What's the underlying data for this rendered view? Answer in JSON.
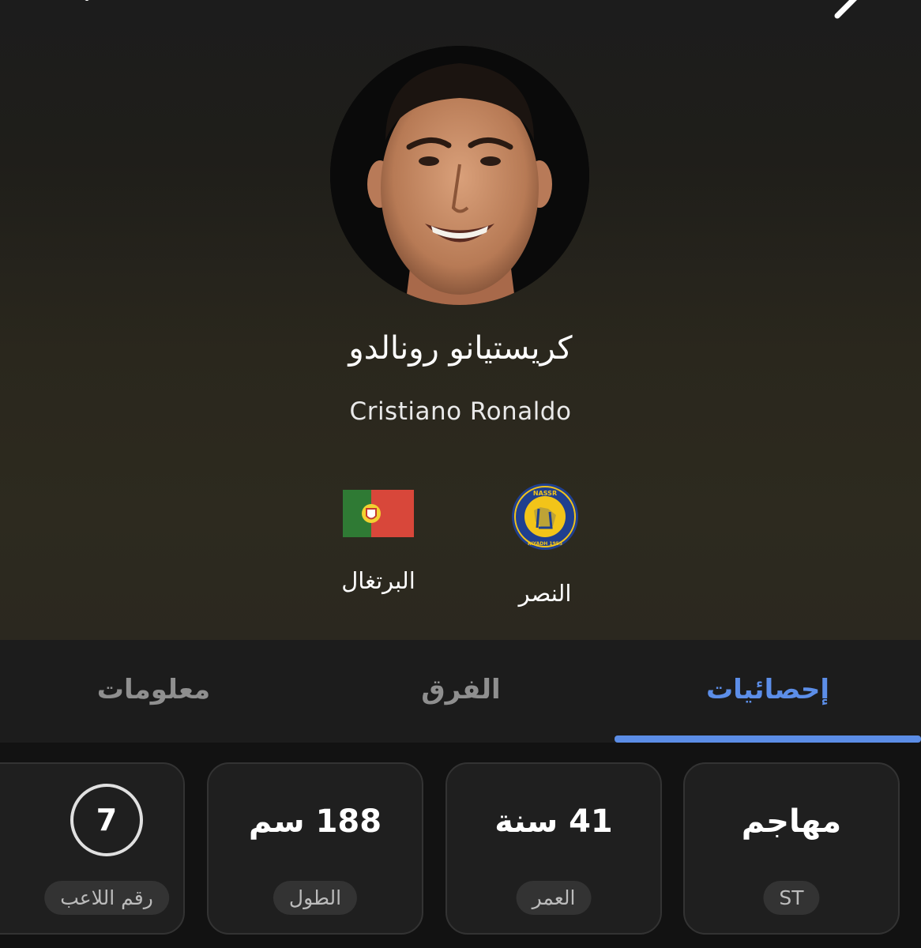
{
  "player": {
    "name_ar": "كريستيانو رونالدو",
    "name_en": "Cristiano Ronaldo"
  },
  "teams": {
    "club": {
      "label": "النصر",
      "crest_text_top": "NASSR",
      "crest_text_bottom": "RIYADH 1955",
      "icon": "al-nassr-crest-icon"
    },
    "country": {
      "label": "البرتغال",
      "icon": "portugal-flag-icon"
    }
  },
  "tabs": [
    {
      "label": "إحصائيات",
      "active": true
    },
    {
      "label": "الفرق",
      "active": false
    },
    {
      "label": "معلومات",
      "active": false
    }
  ],
  "stats": [
    {
      "value": "مهاجم",
      "label": "ST"
    },
    {
      "value": "41 سنة",
      "label": "العمر"
    },
    {
      "value": "188 سم",
      "label": "الطول"
    },
    {
      "value": "7",
      "label": "رقم اللاعب"
    }
  ],
  "colors": {
    "accent": "#5b8de6",
    "background": "#1c1c1c",
    "card": "#1f1f1f",
    "club_blue": "#1f3f8f",
    "club_yellow": "#f2c419",
    "flag_green": "#2f7a34",
    "flag_red": "#d8473a"
  }
}
